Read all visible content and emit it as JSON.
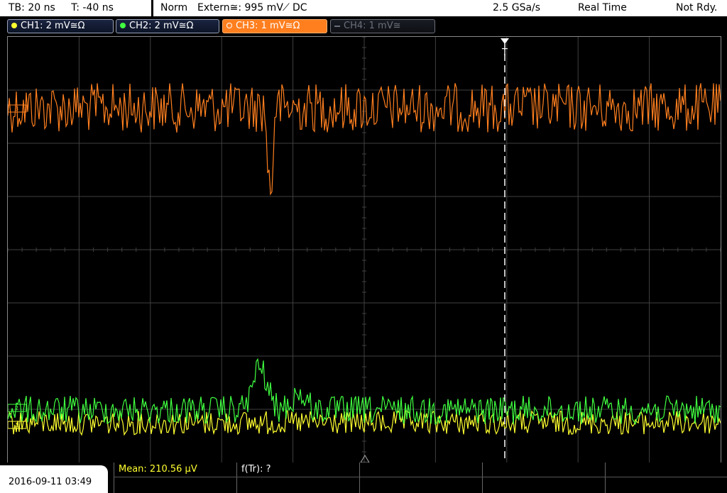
{
  "header": {
    "timebase": "TB: 20 ns",
    "trigger_time": "T: -40 ns",
    "mode": "Norm",
    "trigger_source": "Extern≅: 995 mV",
    "trigger_coupling": "DC",
    "sample_rate": "2.5 GSa/s",
    "acq_mode": "Real Time",
    "status": "Not Rdy."
  },
  "channels": [
    {
      "label": "CH1: 2 mV≅Ω",
      "color": "#ffff30",
      "state": "on"
    },
    {
      "label": "CH2: 2 mV≅Ω",
      "color": "#40ff40",
      "state": "on"
    },
    {
      "label": "CH3: 1 mV≅Ω",
      "color": "#ff7f1f",
      "state": "active"
    },
    {
      "label": "CH4: 1 mV≅",
      "color": "#6b6f7a",
      "state": "off"
    }
  ],
  "markers": {
    "trigger_label": "T",
    "ch3_marker": "3",
    "ch2_marker": "2",
    "ch1_marker": "1"
  },
  "footer": {
    "datetime": "2016-09-11 03:49",
    "measurement_1": "Mean: 210.56 μV",
    "measurement_2": "f(Tr): ?"
  },
  "colors": {
    "ch1": "#ffff30",
    "ch2": "#40ff40",
    "ch3": "#ff7f1f",
    "grid": "#404040",
    "trigger_line": "#ffffff"
  }
}
